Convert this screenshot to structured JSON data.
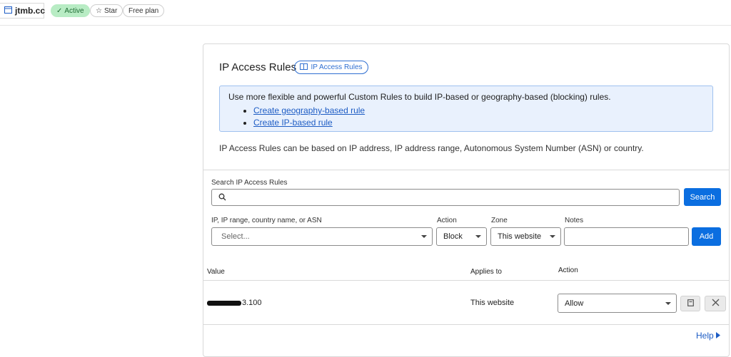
{
  "topbar": {
    "zone_name": "jtmb.cc",
    "status": "Active",
    "star_label": "Star",
    "plan": "Free plan"
  },
  "card": {
    "title": "IP Access Rules",
    "doc_pill": "IP Access Rules",
    "info_text": "Use more flexible and powerful Custom Rules to build IP-based or geography-based (blocking) rules.",
    "info_links": [
      "Create geography-based rule",
      "Create IP-based rule"
    ],
    "description": "IP Access Rules can be based on IP address, IP address range, Autonomous System Number (ASN) or country."
  },
  "search": {
    "label": "Search IP Access Rules",
    "button": "Search"
  },
  "form": {
    "value_label": "IP, IP range, country name, or ASN",
    "value_placeholder": "Select...",
    "action_label": "Action",
    "action_value": "Block",
    "zone_label": "Zone",
    "zone_value": "This website",
    "notes_label": "Notes",
    "add_button": "Add"
  },
  "table": {
    "headers": [
      "Value",
      "Applies to",
      "Action"
    ],
    "rows": [
      {
        "value_suffix": "3.100",
        "applies_to": "This website",
        "action": "Allow"
      }
    ]
  },
  "help": "Help",
  "colors": {
    "accent": "#0b6ee0",
    "active_bg": "#b8ecc4",
    "info_bg": "#e9f1fd"
  }
}
